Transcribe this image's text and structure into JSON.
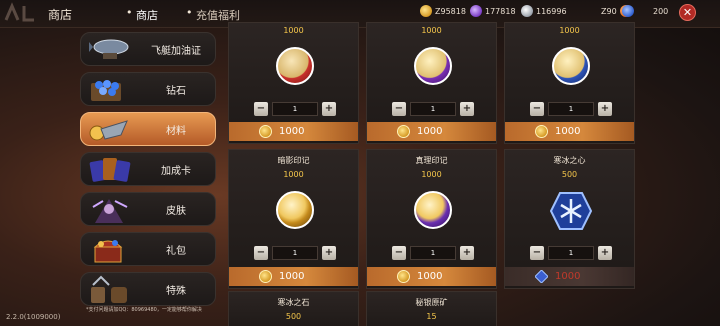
{
  "header": {
    "title": "商店",
    "tabs": [
      "商店",
      "充值福利"
    ],
    "currencies": [
      {
        "icon": "gold-coin-icon",
        "value": "Z95818",
        "color": "#f2c14e"
      },
      {
        "icon": "purple-crystal-icon",
        "value": "177818",
        "color": "#9b6ad6"
      },
      {
        "icon": "silver-coin-icon",
        "value": "116996",
        "color": "#c9ced6"
      },
      {
        "icon": "orange-gem-icon",
        "value": "Z90",
        "color": "#e8742b"
      },
      {
        "icon": "blue-gem-icon",
        "value": "200",
        "color": "#3b6fd8"
      }
    ]
  },
  "sidebar": {
    "items": [
      {
        "label": "飞艇加油证",
        "icon": "airship-icon",
        "active": false
      },
      {
        "label": "钻石",
        "icon": "diamonds-icon",
        "active": false
      },
      {
        "label": "材料",
        "icon": "materials-icon",
        "active": true
      },
      {
        "label": "加成卡",
        "icon": "bonus-cards-icon",
        "active": false
      },
      {
        "label": "皮肤",
        "icon": "skin-icon",
        "active": false
      },
      {
        "label": "礼包",
        "icon": "gift-pack-icon",
        "active": false
      },
      {
        "label": "特殊",
        "icon": "special-icon",
        "active": false
      }
    ],
    "version": "2.2.0(1009000)",
    "support": "*支付问题请加QQ：80969480，一定能够帮你解决"
  },
  "shop": {
    "items": [
      {
        "name": "",
        "limit": "1000",
        "qty": "1",
        "price": "1000",
        "price_icon": "gold-coin-icon",
        "icon": "red-emblem-icon",
        "color": "#c9312c",
        "affordable": true
      },
      {
        "name": "",
        "limit": "1000",
        "qty": "1",
        "price": "1000",
        "price_icon": "gold-coin-icon",
        "icon": "purple-emblem-icon",
        "color": "#7a2fb4",
        "affordable": true
      },
      {
        "name": "",
        "limit": "1000",
        "qty": "1",
        "price": "1000",
        "price_icon": "gold-coin-icon",
        "icon": "blue-emblem-icon",
        "color": "#2f55b8",
        "affordable": true
      },
      {
        "name": "暗影印记",
        "limit": "1000",
        "qty": "1",
        "price": "1000",
        "price_icon": "gold-coin-icon",
        "icon": "shadow-mark-icon",
        "color": "#c48a1c",
        "affordable": true
      },
      {
        "name": "真理印记",
        "limit": "1000",
        "qty": "1",
        "price": "1000",
        "price_icon": "gold-coin-icon",
        "icon": "truth-mark-icon",
        "color": "#6a2fb0",
        "affordable": true
      },
      {
        "name": "寒冰之心",
        "limit": "500",
        "qty": "1",
        "price": "1000",
        "price_icon": "ice-gem-icon",
        "icon": "ice-heart-icon",
        "color": "#2a4fae",
        "affordable": false
      },
      {
        "name": "寒冰之石",
        "limit": "500"
      },
      {
        "name": "秘银原矿",
        "limit": "15"
      }
    ],
    "minus_label": "−",
    "plus_label": "+"
  }
}
